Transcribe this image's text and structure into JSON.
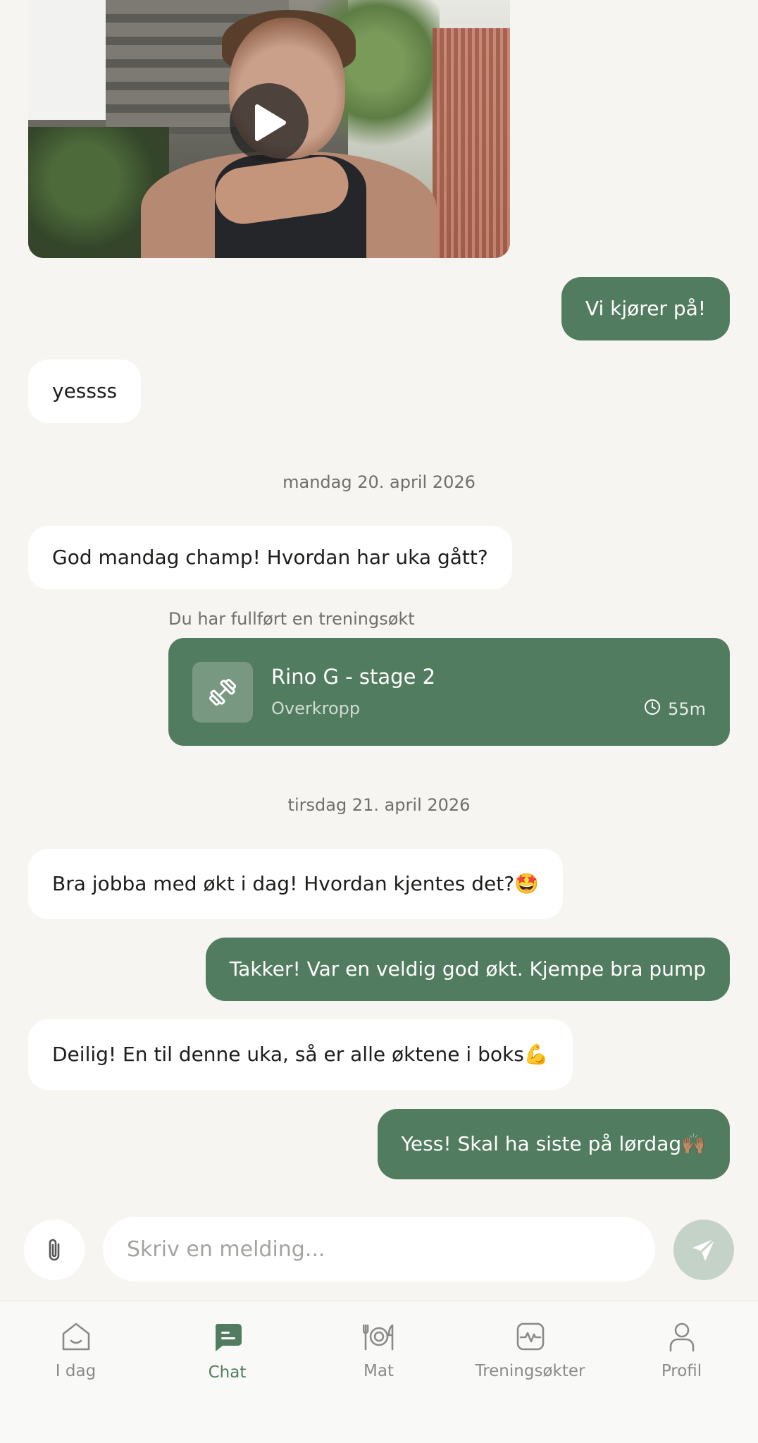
{
  "video": {
    "icon": "play-icon"
  },
  "messages": [
    {
      "side": "out",
      "text": "Vi kjører på!"
    },
    {
      "side": "in",
      "text": "yessss"
    },
    {
      "side": "in",
      "text": "God mandag champ! Hvordan har uka gått?"
    },
    {
      "side": "in",
      "text": "Bra jobba med økt i dag! Hvordan kjentes det?🤩"
    },
    {
      "side": "out",
      "text": "Takker! Var en veldig god økt. Kjempe bra pump"
    },
    {
      "side": "in",
      "text": "Deilig! En til denne uka, så er alle øktene i boks💪"
    },
    {
      "side": "out",
      "text": "Yess! Skal ha siste på lørdag🙌🏽"
    }
  ],
  "dates": [
    "mandag 20. april 2026",
    "tirsdag 21. april 2026"
  ],
  "workout": {
    "label": "Du har fullført en treningsøkt",
    "title": "Rino G - stage 2",
    "subtitle": "Overkropp",
    "duration": "55m",
    "icon": "dumbbell-icon"
  },
  "composer": {
    "placeholder": "Skriv en melding...",
    "attach_icon": "paperclip-icon",
    "send_icon": "send-icon"
  },
  "tabs": [
    {
      "label": "I dag",
      "icon": "home-icon",
      "active": false
    },
    {
      "label": "Chat",
      "icon": "chat-icon",
      "active": true
    },
    {
      "label": "Mat",
      "icon": "plate-icon",
      "active": false
    },
    {
      "label": "Treningsøkter",
      "icon": "activity-icon",
      "active": false
    },
    {
      "label": "Profil",
      "icon": "profile-icon",
      "active": false
    }
  ],
  "colors": {
    "accent": "#527c5f",
    "background": "#f6f5f2",
    "bubble_in": "#ffffff"
  }
}
